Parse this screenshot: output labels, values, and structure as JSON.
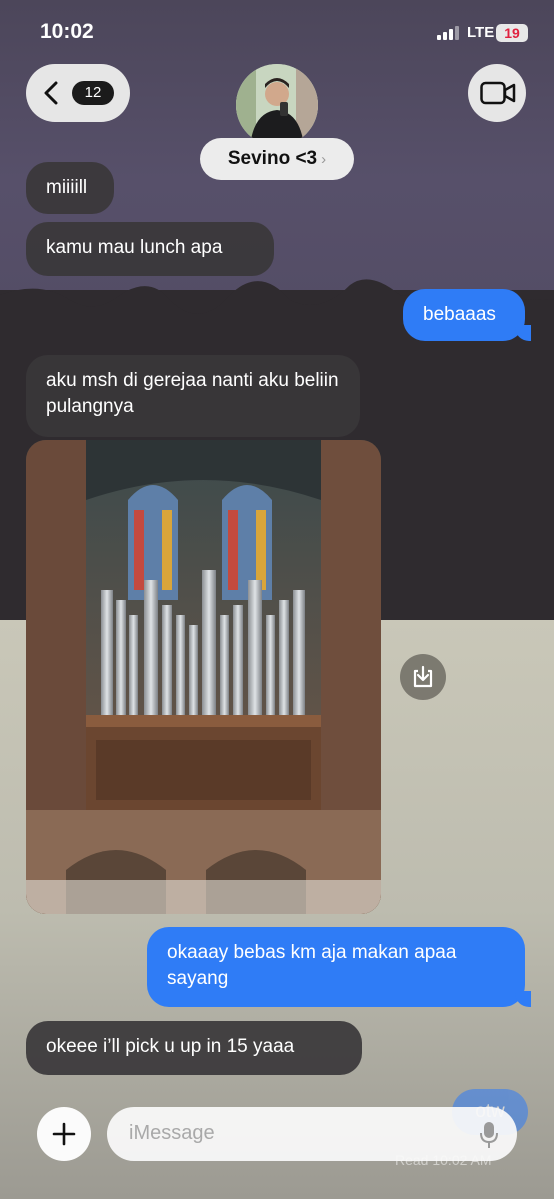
{
  "status_bar": {
    "time": "10:02",
    "network": "LTE",
    "battery": "19"
  },
  "header": {
    "back_count": "12",
    "contact_name": "Sevino <3",
    "contact_chevron": "›",
    "video_icon": "video-camera-icon"
  },
  "messages": [
    {
      "direction": "received",
      "text": "miiiill"
    },
    {
      "direction": "received",
      "text": "kamu mau lunch apa"
    },
    {
      "direction": "sent",
      "text": "bebaaas"
    },
    {
      "direction": "received",
      "text": "aku msh di gerejaa nanti aku beliin pulangnya"
    },
    {
      "direction": "received",
      "type": "photo"
    },
    {
      "direction": "sent",
      "text": "okaaay bebas km aja makan apaa sayang"
    },
    {
      "direction": "received",
      "text": "okeee i’ll pick u up in 15 yaaa"
    },
    {
      "direction": "sent",
      "text": "otw"
    }
  ],
  "read_receipt": "Read 10:02 AM",
  "input": {
    "placeholder": "iMessage"
  },
  "colors": {
    "sent": "#2f7cf6",
    "received": "#3a373a"
  }
}
